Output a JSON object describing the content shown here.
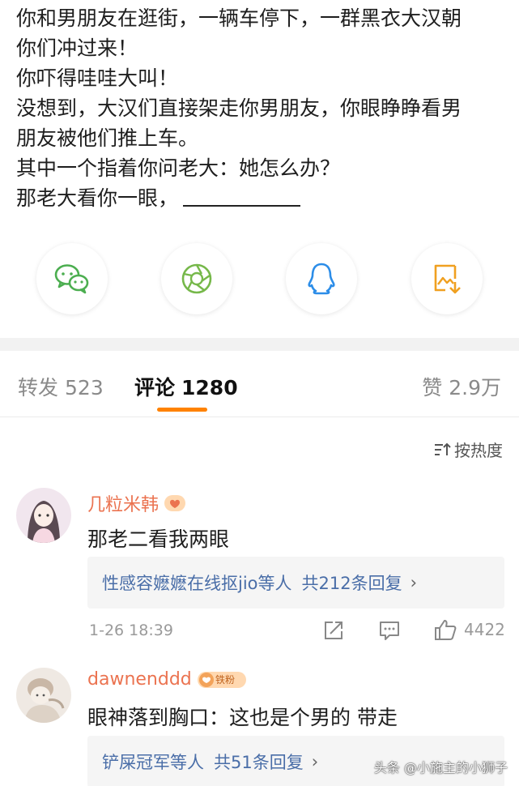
{
  "post": {
    "lines": [
      "你和男朋友在逛街，一辆车停下，一群黑衣大汉朝",
      "你们冲过来！",
      "你吓得哇哇大叫！",
      "没想到，大汉们直接架走你男朋友，你眼睁睁看男",
      "朋友被他们推上车。",
      "其中一个指着你问老大：她怎么办？",
      "那老大看你一眼，"
    ]
  },
  "share": {
    "items": [
      "wechat-icon",
      "moments-icon",
      "qq-icon",
      "save-image-icon"
    ],
    "colors": {
      "wechat": "#4cae50",
      "moments": "#76b84a",
      "qq": "#2c8de8",
      "save": "#f0a020"
    }
  },
  "tabs": {
    "repost_label": "转发",
    "repost_count": "523",
    "comment_label": "评论",
    "comment_count": "1280",
    "like_label": "赞",
    "like_count": "2.9万"
  },
  "sort_label": "按热度",
  "comments": [
    {
      "username": "几粒米韩",
      "text": "那老二看我两眼",
      "reply_summary": "性感容嬷嬷在线抠jio等人",
      "reply_count": "共212条回复",
      "time": "1-26 18:39",
      "likes": "4422"
    },
    {
      "username": "dawnenddd",
      "badge_text": "铁粉",
      "text": "眼神落到胸口：这也是个男的 带走",
      "reply_summary": "铲屎冠军等人",
      "reply_count": "共51条回复"
    }
  ],
  "watermark": "头条 @小施主的小狮子",
  "colors": {
    "accent": "#ff8200",
    "username": "#eb7350",
    "link": "#4a6ea8"
  }
}
